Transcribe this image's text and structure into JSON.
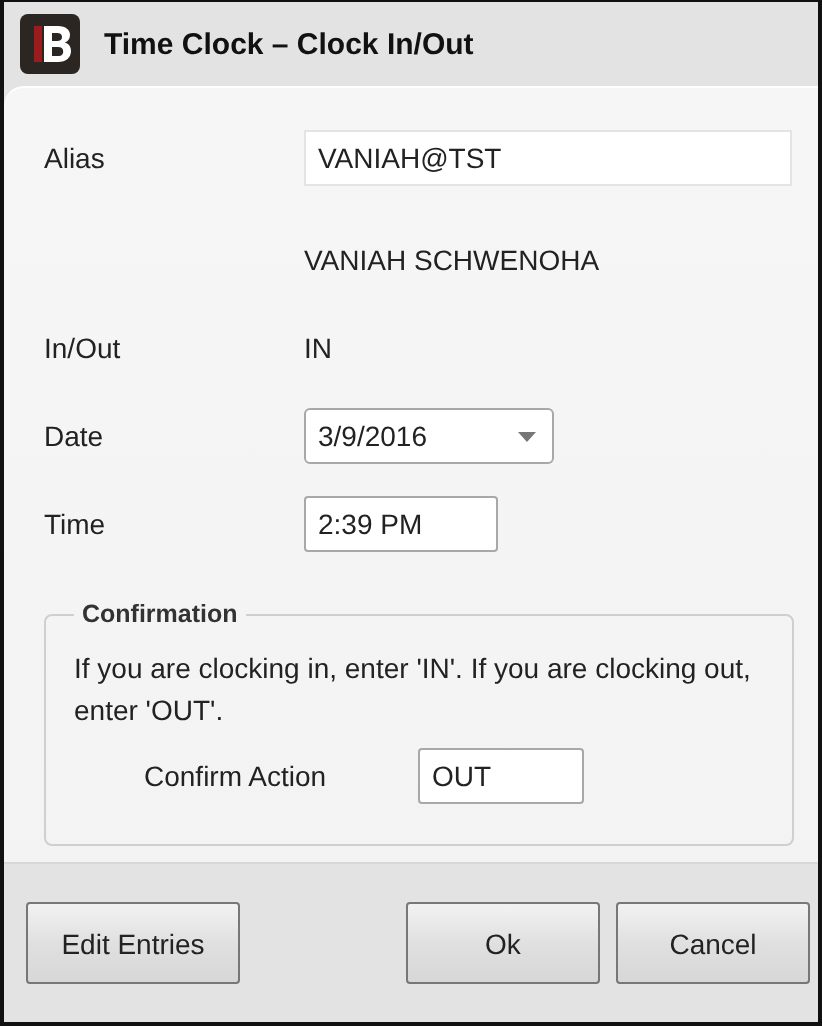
{
  "window": {
    "title": "Time Clock – Clock In/Out"
  },
  "rows": [
    {
      "kind": "input",
      "label": "Alias",
      "value": "VANIAH@TST"
    },
    {
      "kind": "static",
      "value": "VANIAH SCHWENOHA"
    },
    {
      "kind": "static",
      "label": "In/Out",
      "value": "IN"
    },
    {
      "kind": "dropdown",
      "label": "Date",
      "value": "3/9/2016"
    },
    {
      "kind": "time",
      "label": "Time",
      "value": "2:39 PM"
    }
  ],
  "confirmation": {
    "title": "Confirmation",
    "message": "If you are clocking in, enter 'IN'. If you are clocking out, enter 'OUT'.",
    "label": "Confirm Action",
    "value": "OUT"
  },
  "footer": {
    "left_buttons": [
      "Edit Entries"
    ],
    "right_buttons": [
      "Ok",
      "Cancel"
    ]
  }
}
